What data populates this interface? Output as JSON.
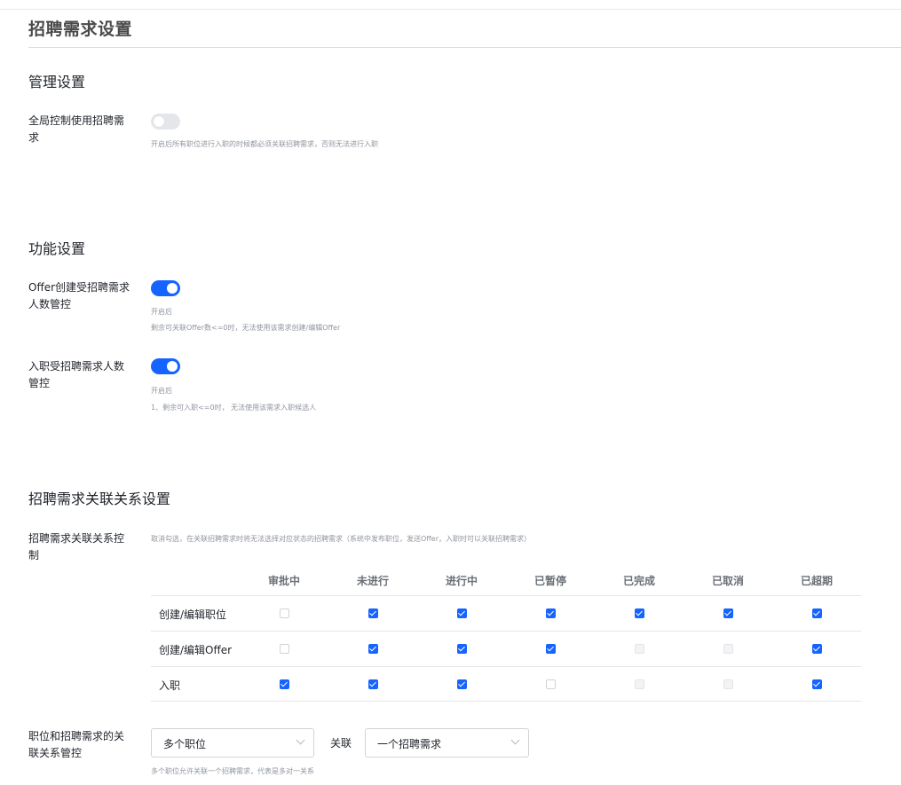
{
  "page": {
    "title": "招聘需求设置"
  },
  "management": {
    "title": "管理设置",
    "global_control": {
      "label": "全局控制使用招聘需求",
      "enabled": false,
      "hint": "开启后所有职位进行入职的时候都必须关联招聘需求，否则无法进行入职"
    }
  },
  "features": {
    "title": "功能设置",
    "offer_control": {
      "label": "Offer创建受招聘需求人数管控",
      "enabled": true,
      "hint_1": "开启后",
      "hint_2": "剩余可关联Offer数<=0时，无法使用该需求创建/编辑Offer"
    },
    "onboard_control": {
      "label": "入职受招聘需求人数管控",
      "enabled": true,
      "hint_1": "开启后",
      "hint_2": "1、剩余可入职<=0时， 无法使用该需求入职候选人"
    }
  },
  "relations": {
    "title": "招聘需求关联关系设置",
    "control": {
      "label": "招聘需求关联关系控制",
      "hint": "取消勾选，在关联招聘需求时将无法选择对应状态的招聘需求（系统中发布职位，发送Offer，入职时可以关联招聘需求）"
    },
    "matrix": {
      "columns": [
        "审批中",
        "未进行",
        "进行中",
        "已暂停",
        "已完成",
        "已取消",
        "已超期"
      ],
      "rows": [
        {
          "label": "创建/编辑职位",
          "cells": [
            "empty",
            "checked",
            "checked",
            "checked",
            "checked",
            "checked",
            "checked"
          ]
        },
        {
          "label": "创建/编辑Offer",
          "cells": [
            "empty",
            "checked",
            "checked",
            "checked",
            "disabled",
            "disabled",
            "checked"
          ]
        },
        {
          "label": "入职",
          "cells": [
            "checked",
            "checked",
            "checked",
            "empty",
            "disabled",
            "disabled",
            "checked"
          ]
        }
      ]
    },
    "mapping": {
      "label": "职位和招聘需求的关联关系管控",
      "position_select": "多个职位",
      "relation_word": "关联",
      "requirement_select": "一个招聘需求",
      "hint": "多个职位允许关联一个招聘需求，代表是多对一关系"
    }
  },
  "colors": {
    "accent": "#1664ff",
    "hint": "#8f959e",
    "border": "#e5e6eb"
  }
}
